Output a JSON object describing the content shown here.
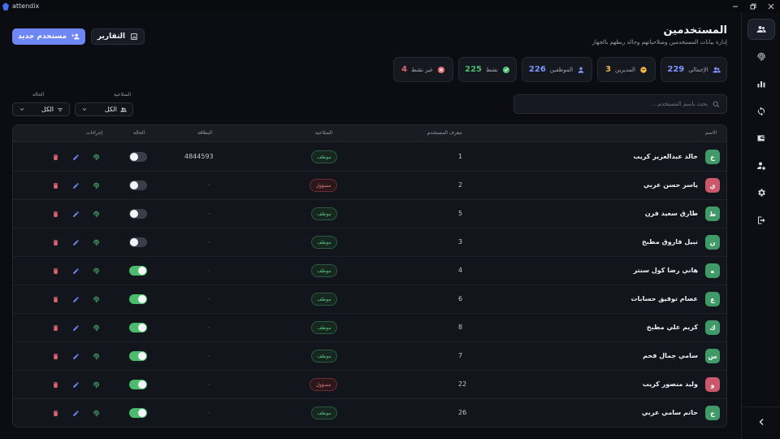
{
  "window": {
    "title": "attendix",
    "controls": [
      "minimize",
      "restore",
      "close"
    ]
  },
  "header": {
    "title": "المستخدمين",
    "subtitle": "إدارة بيانات المستخدمين وصلاحياتهم وحالة ربطهم بالجهاز",
    "new_user_label": "مستخدم جديد",
    "reports_label": "التقارير"
  },
  "stats": [
    {
      "label": "الإجمالي",
      "value": "229",
      "icon": "users-icon",
      "color": "#7e93ff"
    },
    {
      "label": "المديرين",
      "value": "3",
      "icon": "manager-icon",
      "color": "#f0b54a"
    },
    {
      "label": "الموظفين",
      "value": "226",
      "icon": "person-icon",
      "color": "#7e93ff"
    },
    {
      "label": "نشط",
      "value": "225",
      "icon": "check-circle-icon",
      "color": "#4bbb6e"
    },
    {
      "label": "غير نشط",
      "value": "4",
      "icon": "x-circle-icon",
      "color": "#e06570"
    }
  ],
  "search": {
    "placeholder": "بحث باسم المستخدم..."
  },
  "filters": {
    "role_label": "الصلاحية",
    "role_value": "الكل",
    "status_label": "الحالة",
    "status_value": "الكل"
  },
  "table": {
    "columns": {
      "name": "الاسم",
      "user_id": "معرف المستخدم",
      "role": "الصلاحية",
      "card": "البطاقة",
      "status": "الحالة",
      "actions": "إجراءات"
    },
    "rows": [
      {
        "initial": "خ",
        "name": "خالد عبدالعزيز كريب",
        "id": "1",
        "role": "موظف",
        "role_type": "employee",
        "card": "4844593",
        "active": false
      },
      {
        "initial": "ي",
        "name": "ياسر حسن عربي",
        "id": "2",
        "role": "مسؤول",
        "role_type": "manager",
        "card": "-",
        "active": false
      },
      {
        "initial": "ط",
        "name": "طارق سعيد فرن",
        "id": "5",
        "role": "موظف",
        "role_type": "employee",
        "card": "-",
        "active": false
      },
      {
        "initial": "ن",
        "name": "نبيل فاروق مطبخ",
        "id": "3",
        "role": "موظف",
        "role_type": "employee",
        "card": "-",
        "active": false
      },
      {
        "initial": "ه",
        "name": "هاني رضا كول سنتر",
        "id": "4",
        "role": "موظف",
        "role_type": "employee",
        "card": "-",
        "active": true
      },
      {
        "initial": "ع",
        "name": "عصام توفيق حسابات",
        "id": "6",
        "role": "موظف",
        "role_type": "employee",
        "card": "-",
        "active": true
      },
      {
        "initial": "ك",
        "name": "كريم علي مطبخ",
        "id": "8",
        "role": "موظف",
        "role_type": "employee",
        "card": "-",
        "active": true
      },
      {
        "initial": "س",
        "name": "سامي جمال فحم",
        "id": "7",
        "role": "موظف",
        "role_type": "employee",
        "card": "-",
        "active": true
      },
      {
        "initial": "و",
        "name": "وليد منصور كريب",
        "id": "22",
        "role": "مسؤول",
        "role_type": "manager",
        "card": "-",
        "active": true
      },
      {
        "initial": "ح",
        "name": "حاتم سامي عربي",
        "id": "26",
        "role": "موظف",
        "role_type": "employee",
        "card": "-",
        "active": true
      }
    ]
  },
  "sidebar": {
    "items": [
      {
        "icon": "users-icon",
        "active": true
      },
      {
        "icon": "fingerprint-icon",
        "active": false
      },
      {
        "icon": "bar-chart-icon",
        "active": false
      },
      {
        "icon": "sync-icon",
        "active": false
      },
      {
        "icon": "wallet-icon",
        "active": false
      },
      {
        "icon": "user-settings-icon",
        "active": false
      },
      {
        "icon": "gear-icon",
        "active": false
      },
      {
        "icon": "logout-icon",
        "active": false
      }
    ],
    "collapse_icon": "chevron-left-icon"
  },
  "colors": {
    "accent": "#6f86f5",
    "employee_avatar": "#3f9a67",
    "manager_avatar": "#c9596a",
    "active_toggle": "#4bbb6e",
    "delete": "#e06570",
    "edit": "#6f86f5",
    "fingerprint": "#4bbb6e"
  }
}
